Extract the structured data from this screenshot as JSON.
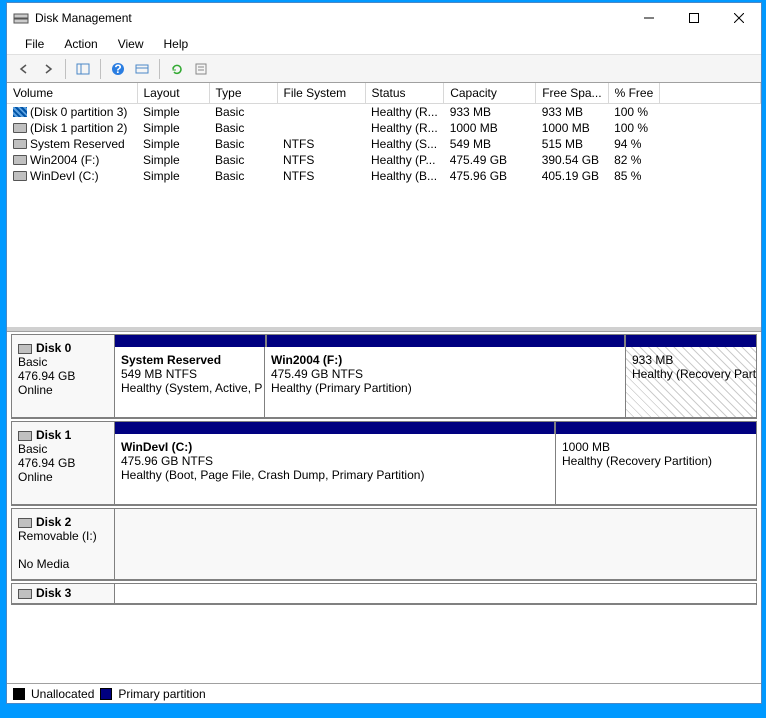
{
  "window": {
    "title": "Disk Management"
  },
  "menu": {
    "file": "File",
    "action": "Action",
    "view": "View",
    "help": "Help"
  },
  "columns": {
    "volume": "Volume",
    "layout": "Layout",
    "type": "Type",
    "fs": "File System",
    "status": "Status",
    "capacity": "Capacity",
    "free": "Free Spa...",
    "pct": "% Free"
  },
  "volumes": [
    {
      "iconStyle": "striped",
      "name": "(Disk 0 partition 3)",
      "layout": "Simple",
      "type": "Basic",
      "fs": "",
      "status": "Healthy (R...",
      "capacity": "933 MB",
      "free": "933 MB",
      "pct": "100 %"
    },
    {
      "iconStyle": "drive",
      "name": "(Disk 1 partition 2)",
      "layout": "Simple",
      "type": "Basic",
      "fs": "",
      "status": "Healthy (R...",
      "capacity": "1000 MB",
      "free": "1000 MB",
      "pct": "100 %"
    },
    {
      "iconStyle": "drive",
      "name": "System Reserved",
      "layout": "Simple",
      "type": "Basic",
      "fs": "NTFS",
      "status": "Healthy (S...",
      "capacity": "549 MB",
      "free": "515 MB",
      "pct": "94 %"
    },
    {
      "iconStyle": "drive",
      "name": "Win2004 (F:)",
      "layout": "Simple",
      "type": "Basic",
      "fs": "NTFS",
      "status": "Healthy (P...",
      "capacity": "475.49 GB",
      "free": "390.54 GB",
      "pct": "82 %"
    },
    {
      "iconStyle": "drive",
      "name": "WinDevI (C:)",
      "layout": "Simple",
      "type": "Basic",
      "fs": "NTFS",
      "status": "Healthy (B...",
      "capacity": "475.96 GB",
      "free": "405.19 GB",
      "pct": "85 %"
    }
  ],
  "disks": {
    "d0": {
      "name": "Disk 0",
      "type": "Basic",
      "size": "476.94 GB",
      "state": "Online",
      "p0": {
        "name": "System Reserved",
        "sub": "549 MB NTFS",
        "status": "Healthy (System, Active, P"
      },
      "p1": {
        "name": "Win2004  (F:)",
        "sub": "475.49 GB NTFS",
        "status": "Healthy (Primary Partition)"
      },
      "p2": {
        "name": "",
        "sub": "933 MB",
        "status": "Healthy (Recovery Partition)"
      }
    },
    "d1": {
      "name": "Disk 1",
      "type": "Basic",
      "size": "476.94 GB",
      "state": "Online",
      "p0": {
        "name": "WinDevI  (C:)",
        "sub": "475.96 GB NTFS",
        "status": "Healthy (Boot, Page File, Crash Dump, Primary Partition)"
      },
      "p1": {
        "name": "",
        "sub": "1000 MB",
        "status": "Healthy (Recovery Partition)"
      }
    },
    "d2": {
      "name": "Disk 2",
      "type": "Removable (I:)",
      "nomedia": "No Media"
    },
    "d3": {
      "name": "Disk 3"
    }
  },
  "legend": {
    "unallocated": "Unallocated",
    "primary": "Primary partition"
  }
}
